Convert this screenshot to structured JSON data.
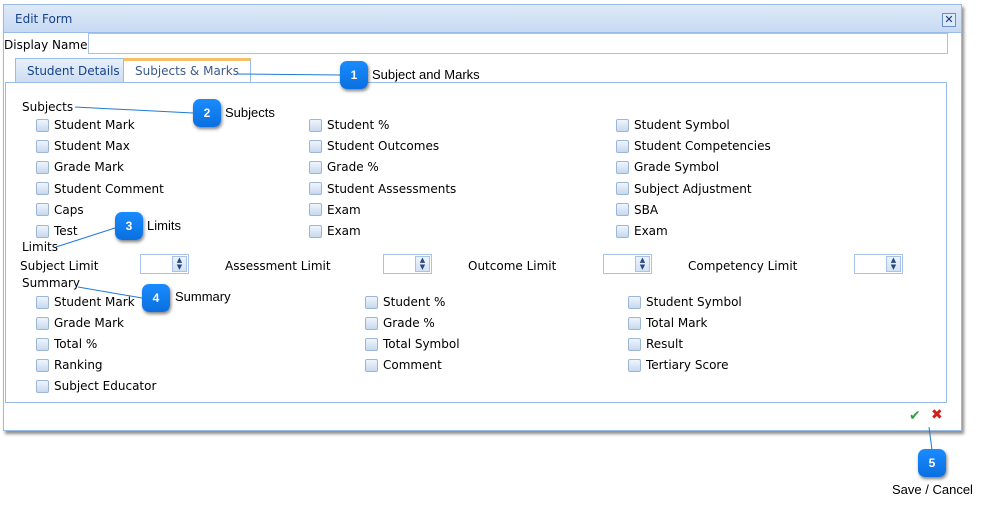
{
  "dialog": {
    "title": "Edit Form",
    "close_icon": "close-icon"
  },
  "display_name": {
    "label": "Display Name",
    "required_marker": "*",
    "value": ""
  },
  "tabs": [
    {
      "label": "Student Details",
      "active": false
    },
    {
      "label": "Subjects & Marks",
      "active": true
    }
  ],
  "subjects": {
    "label": "Subjects",
    "columns": [
      [
        {
          "label": "Student Mark",
          "checked": false
        },
        {
          "label": "Student Max",
          "checked": false
        },
        {
          "label": "Grade Mark",
          "checked": false
        },
        {
          "label": "Student Comment",
          "checked": false
        },
        {
          "label": "Caps",
          "checked": false
        },
        {
          "label": "Test",
          "checked": false
        }
      ],
      [
        {
          "label": "Student %",
          "checked": false
        },
        {
          "label": "Student Outcomes",
          "checked": false
        },
        {
          "label": "Grade %",
          "checked": false
        },
        {
          "label": "Student Assessments",
          "checked": false
        },
        {
          "label": "Exam",
          "checked": false
        },
        {
          "label": "Exam",
          "checked": false
        }
      ],
      [
        {
          "label": "Student Symbol",
          "checked": false
        },
        {
          "label": "Student Competencies",
          "checked": false
        },
        {
          "label": "Grade Symbol",
          "checked": false
        },
        {
          "label": "Subject Adjustment",
          "checked": false
        },
        {
          "label": "SBA",
          "checked": false
        },
        {
          "label": "Exam",
          "checked": false
        }
      ]
    ]
  },
  "limits": {
    "label": "Limits",
    "fields": [
      {
        "label": "Subject Limit",
        "value": ""
      },
      {
        "label": "Assessment Limit",
        "value": ""
      },
      {
        "label": "Outcome Limit",
        "value": ""
      },
      {
        "label": "Competency Limit",
        "value": ""
      }
    ]
  },
  "summary": {
    "label": "Summary",
    "columns": [
      [
        {
          "label": "Student Mark",
          "checked": false
        },
        {
          "label": "Grade Mark",
          "checked": false
        },
        {
          "label": "Total %",
          "checked": false
        },
        {
          "label": "Ranking",
          "checked": false
        },
        {
          "label": "Subject Educator",
          "checked": false
        }
      ],
      [
        {
          "label": "Student %",
          "checked": false
        },
        {
          "label": "Grade %",
          "checked": false
        },
        {
          "label": "Total Symbol",
          "checked": false
        },
        {
          "label": "Comment",
          "checked": false
        }
      ],
      [
        {
          "label": "Student Symbol",
          "checked": false
        },
        {
          "label": "Total Mark",
          "checked": false
        },
        {
          "label": "Result",
          "checked": false
        },
        {
          "label": "Tertiary Score",
          "checked": false
        }
      ]
    ]
  },
  "footer": {
    "save_icon": "checkmark-icon",
    "cancel_icon": "cross-icon"
  },
  "callouts": [
    {
      "number": "1",
      "text": "Subject and Marks"
    },
    {
      "number": "2",
      "text": "Subjects"
    },
    {
      "number": "3",
      "text": "Limits"
    },
    {
      "number": "4",
      "text": "Summary"
    },
    {
      "number": "5",
      "text": "Save / Cancel"
    }
  ],
  "colors": {
    "accent": "#15428b",
    "border": "#99bbe8",
    "callout": "#0a7cf5",
    "active_tab_marker": "#f6bf68",
    "save": "#35a047",
    "cancel": "#d21e1e"
  }
}
